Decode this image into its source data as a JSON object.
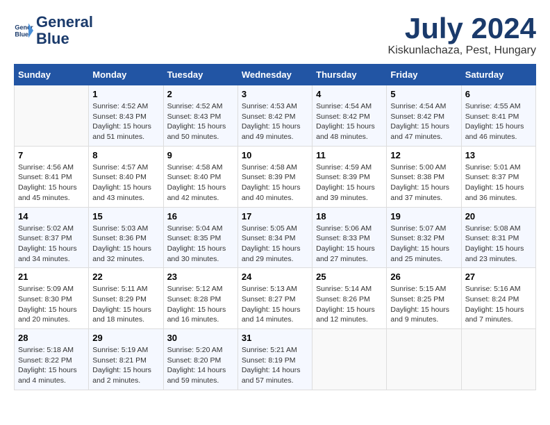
{
  "header": {
    "logo_line1": "General",
    "logo_line2": "Blue",
    "month": "July 2024",
    "location": "Kiskunlachaza, Pest, Hungary"
  },
  "days_of_week": [
    "Sunday",
    "Monday",
    "Tuesday",
    "Wednesday",
    "Thursday",
    "Friday",
    "Saturday"
  ],
  "weeks": [
    [
      {
        "day": "",
        "info": ""
      },
      {
        "day": "1",
        "info": "Sunrise: 4:52 AM\nSunset: 8:43 PM\nDaylight: 15 hours\nand 51 minutes."
      },
      {
        "day": "2",
        "info": "Sunrise: 4:52 AM\nSunset: 8:43 PM\nDaylight: 15 hours\nand 50 minutes."
      },
      {
        "day": "3",
        "info": "Sunrise: 4:53 AM\nSunset: 8:42 PM\nDaylight: 15 hours\nand 49 minutes."
      },
      {
        "day": "4",
        "info": "Sunrise: 4:54 AM\nSunset: 8:42 PM\nDaylight: 15 hours\nand 48 minutes."
      },
      {
        "day": "5",
        "info": "Sunrise: 4:54 AM\nSunset: 8:42 PM\nDaylight: 15 hours\nand 47 minutes."
      },
      {
        "day": "6",
        "info": "Sunrise: 4:55 AM\nSunset: 8:41 PM\nDaylight: 15 hours\nand 46 minutes."
      }
    ],
    [
      {
        "day": "7",
        "info": "Sunrise: 4:56 AM\nSunset: 8:41 PM\nDaylight: 15 hours\nand 45 minutes."
      },
      {
        "day": "8",
        "info": "Sunrise: 4:57 AM\nSunset: 8:40 PM\nDaylight: 15 hours\nand 43 minutes."
      },
      {
        "day": "9",
        "info": "Sunrise: 4:58 AM\nSunset: 8:40 PM\nDaylight: 15 hours\nand 42 minutes."
      },
      {
        "day": "10",
        "info": "Sunrise: 4:58 AM\nSunset: 8:39 PM\nDaylight: 15 hours\nand 40 minutes."
      },
      {
        "day": "11",
        "info": "Sunrise: 4:59 AM\nSunset: 8:39 PM\nDaylight: 15 hours\nand 39 minutes."
      },
      {
        "day": "12",
        "info": "Sunrise: 5:00 AM\nSunset: 8:38 PM\nDaylight: 15 hours\nand 37 minutes."
      },
      {
        "day": "13",
        "info": "Sunrise: 5:01 AM\nSunset: 8:37 PM\nDaylight: 15 hours\nand 36 minutes."
      }
    ],
    [
      {
        "day": "14",
        "info": "Sunrise: 5:02 AM\nSunset: 8:37 PM\nDaylight: 15 hours\nand 34 minutes."
      },
      {
        "day": "15",
        "info": "Sunrise: 5:03 AM\nSunset: 8:36 PM\nDaylight: 15 hours\nand 32 minutes."
      },
      {
        "day": "16",
        "info": "Sunrise: 5:04 AM\nSunset: 8:35 PM\nDaylight: 15 hours\nand 30 minutes."
      },
      {
        "day": "17",
        "info": "Sunrise: 5:05 AM\nSunset: 8:34 PM\nDaylight: 15 hours\nand 29 minutes."
      },
      {
        "day": "18",
        "info": "Sunrise: 5:06 AM\nSunset: 8:33 PM\nDaylight: 15 hours\nand 27 minutes."
      },
      {
        "day": "19",
        "info": "Sunrise: 5:07 AM\nSunset: 8:32 PM\nDaylight: 15 hours\nand 25 minutes."
      },
      {
        "day": "20",
        "info": "Sunrise: 5:08 AM\nSunset: 8:31 PM\nDaylight: 15 hours\nand 23 minutes."
      }
    ],
    [
      {
        "day": "21",
        "info": "Sunrise: 5:09 AM\nSunset: 8:30 PM\nDaylight: 15 hours\nand 20 minutes."
      },
      {
        "day": "22",
        "info": "Sunrise: 5:11 AM\nSunset: 8:29 PM\nDaylight: 15 hours\nand 18 minutes."
      },
      {
        "day": "23",
        "info": "Sunrise: 5:12 AM\nSunset: 8:28 PM\nDaylight: 15 hours\nand 16 minutes."
      },
      {
        "day": "24",
        "info": "Sunrise: 5:13 AM\nSunset: 8:27 PM\nDaylight: 15 hours\nand 14 minutes."
      },
      {
        "day": "25",
        "info": "Sunrise: 5:14 AM\nSunset: 8:26 PM\nDaylight: 15 hours\nand 12 minutes."
      },
      {
        "day": "26",
        "info": "Sunrise: 5:15 AM\nSunset: 8:25 PM\nDaylight: 15 hours\nand 9 minutes."
      },
      {
        "day": "27",
        "info": "Sunrise: 5:16 AM\nSunset: 8:24 PM\nDaylight: 15 hours\nand 7 minutes."
      }
    ],
    [
      {
        "day": "28",
        "info": "Sunrise: 5:18 AM\nSunset: 8:22 PM\nDaylight: 15 hours\nand 4 minutes."
      },
      {
        "day": "29",
        "info": "Sunrise: 5:19 AM\nSunset: 8:21 PM\nDaylight: 15 hours\nand 2 minutes."
      },
      {
        "day": "30",
        "info": "Sunrise: 5:20 AM\nSunset: 8:20 PM\nDaylight: 14 hours\nand 59 minutes."
      },
      {
        "day": "31",
        "info": "Sunrise: 5:21 AM\nSunset: 8:19 PM\nDaylight: 14 hours\nand 57 minutes."
      },
      {
        "day": "",
        "info": ""
      },
      {
        "day": "",
        "info": ""
      },
      {
        "day": "",
        "info": ""
      }
    ]
  ]
}
